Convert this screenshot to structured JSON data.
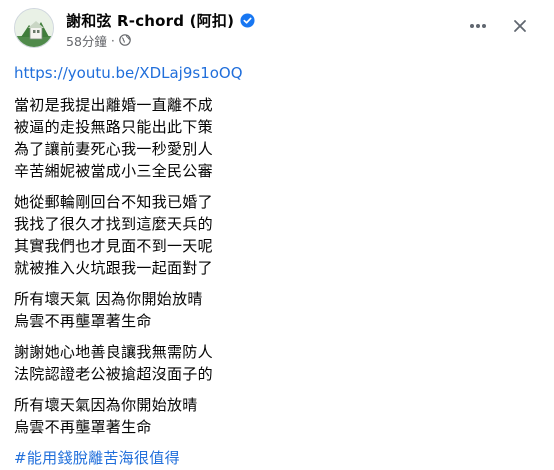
{
  "post": {
    "page_name": "謝和弦 R-chord (阿扣)",
    "timestamp": "58分鐘",
    "meta_separator": "·",
    "link": "https://youtu.be/XDLaj9s1oOQ",
    "paragraphs": [
      {
        "lines": [
          "當初是我提出離婚一直離不成",
          "被逼的走投無路只能出此下策",
          "為了讓前妻死心我一秒愛別人",
          "辛苦緗妮被當成小三全民公審"
        ]
      },
      {
        "lines": [
          "她從郵輪剛回台不知我已婚了",
          "我找了很久才找到這麼天兵的",
          "其實我們也才見面不到一天呢",
          "就被推入火坑跟我一起面對了"
        ]
      },
      {
        "lines": [
          "所有壞天氣 因為你開始放晴",
          "烏雲不再壟罩著生命"
        ]
      },
      {
        "lines": [
          "謝謝她心地善良讓我無需防人",
          "法院認證老公被搶超沒面子的"
        ]
      },
      {
        "lines": [
          "所有壞天氣因為你開始放晴",
          "烏雲不再壟罩著生命"
        ]
      }
    ],
    "hashtag": "#能用錢脫離苦海很值得"
  },
  "icons": {
    "verified": "verified-badge-icon",
    "globe": "globe-icon",
    "more": "more-options-icon",
    "close": "close-icon"
  },
  "colors": {
    "link": "#216fdb",
    "verified": "#1877f2",
    "meta": "#65676b"
  }
}
